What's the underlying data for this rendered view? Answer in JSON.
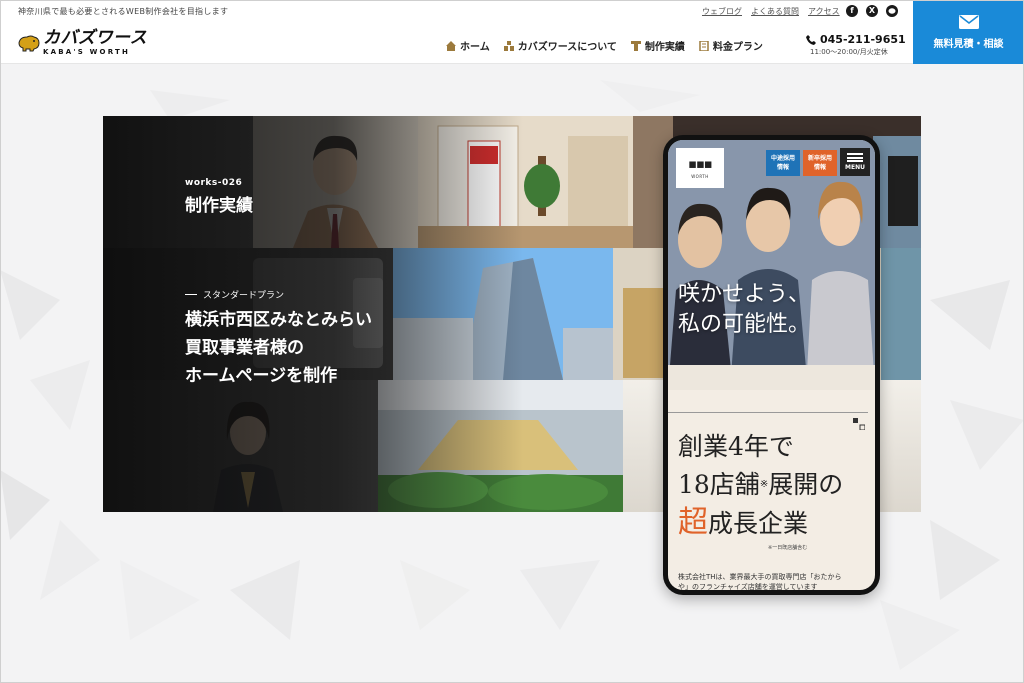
{
  "header": {
    "tagline": "神奈川県で最も必要とされるWEB制作会社を目指します",
    "logo_main": "カバズワース",
    "logo_sub": "KABA'S WORTH",
    "toplinks": [
      "ウェブログ",
      "よくある質問",
      "アクセス"
    ],
    "socials": [
      "facebook-icon",
      "x-icon",
      "line-icon"
    ],
    "nav": [
      {
        "label": "ホーム",
        "icon": "home-icon"
      },
      {
        "label": "カバズワースについて",
        "icon": "company-icon"
      },
      {
        "label": "制作実績",
        "icon": "works-icon"
      },
      {
        "label": "料金プラン",
        "icon": "price-icon"
      }
    ],
    "phone_number": "045-211-9651",
    "phone_hours": "11:00〜20:00/月火定休",
    "cta_label": "無料見積・相談"
  },
  "hero": {
    "works_id": "works-026",
    "works_title": "制作実績",
    "plan_label": "スタンダードプラン",
    "headline_lines": [
      "横浜市西区みなとみらい",
      "買取事業者様の",
      "ホームページを制作"
    ]
  },
  "phone_mockup": {
    "logo_sub": "WORTH",
    "badge_mid": [
      "中途採用",
      "情報"
    ],
    "badge_new": [
      "新卒採用",
      "情報"
    ],
    "menu_label": "MENU",
    "catch_lines": [
      "咲かせよう、",
      "私の可能性。"
    ],
    "heading_line1": "創業4年で",
    "heading_line2": "18店舗",
    "heading_note": "※",
    "heading_line2b": "展開の",
    "heading_line3_accent": "超",
    "heading_line3": "成長企業",
    "heading_sub": "※一日既店舗含む",
    "body_text": "株式会社THは、業界最大手の買取専門店「おたから",
    "body_text2": "や」のフランチャイズ店舗を運営しています"
  },
  "colors": {
    "cta": "#1a8ad8",
    "accent_orange": "#e0632a",
    "badge_blue": "#1f73b7"
  }
}
